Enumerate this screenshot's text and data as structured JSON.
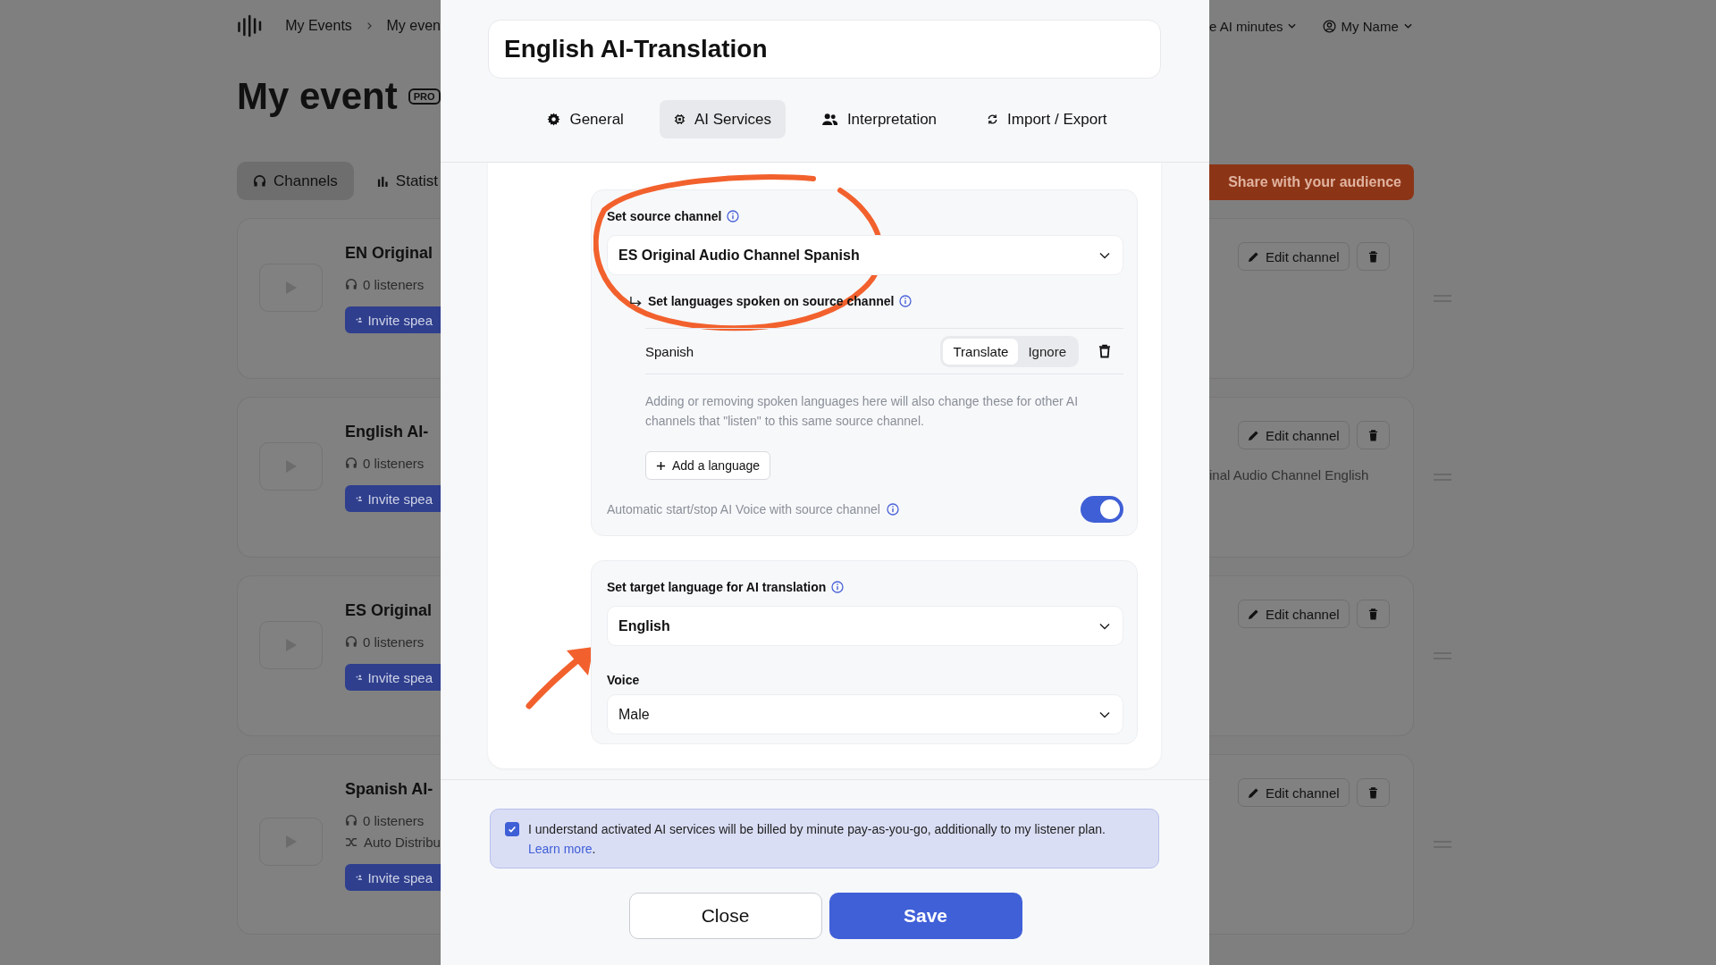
{
  "header": {
    "breadcrumb": [
      "My Events",
      "My even"
    ],
    "ai_minutes": "e AI minutes",
    "user": "My Name"
  },
  "page_title": "My event",
  "badge": "PRO",
  "page_tabs": [
    {
      "label": "Channels",
      "selected": true,
      "kind": "channels"
    },
    {
      "label": "Statist",
      "selected": false,
      "kind": "stats"
    }
  ],
  "share_button": "Share with your audience",
  "channels": [
    {
      "name": "EN Original",
      "listeners": "0 listeners",
      "invite": "Invite spea",
      "edit": "Edit channel"
    },
    {
      "name": "English AI-",
      "listeners": "0 listeners",
      "invite": "Invite spea",
      "edit": "Edit channel",
      "source_note": "inal Audio Channel English"
    },
    {
      "name": "ES Original",
      "listeners": "0 listeners",
      "invite": "Invite spea",
      "edit": "Edit channel"
    },
    {
      "name": "Spanish AI-",
      "listeners": "0 listeners",
      "distribution": "Auto Distribu",
      "invite": "Invite spea",
      "edit": "Edit channel"
    }
  ],
  "modal": {
    "name_field": "English AI-Translation",
    "tabs": [
      {
        "label": "General",
        "selected": false,
        "kind": "gear"
      },
      {
        "label": "AI Services",
        "selected": true,
        "kind": "chip"
      },
      {
        "label": "Interpretation",
        "selected": false,
        "kind": "people"
      },
      {
        "label": "Import / Export",
        "selected": false,
        "kind": "sync"
      }
    ],
    "source": {
      "label": "Set source channel",
      "value": "ES Original Audio Channel Spanish",
      "languages_label": "Set languages spoken on source channel",
      "languages": [
        {
          "name": "Spanish",
          "options": [
            {
              "label": "Translate",
              "selected": true
            },
            {
              "label": "Ignore",
              "selected": false
            }
          ]
        }
      ],
      "note": "Adding or removing spoken languages here will also change these for other AI channels that \"listen\" to this same source channel.",
      "add_button": "Add a language",
      "auto_label": "Automatic start/stop AI Voice with source channel",
      "auto_on": true
    },
    "target": {
      "label": "Set target language for AI translation",
      "value": "English",
      "voice_label": "Voice",
      "voice_value": "Male"
    },
    "consent": {
      "checked": true,
      "text": "I understand activated AI services will be billed by minute pay-as-you-go, additionally to my listener plan.",
      "link": "Learn more",
      "after": "."
    },
    "close_button": "Close",
    "save_button": "Save"
  }
}
